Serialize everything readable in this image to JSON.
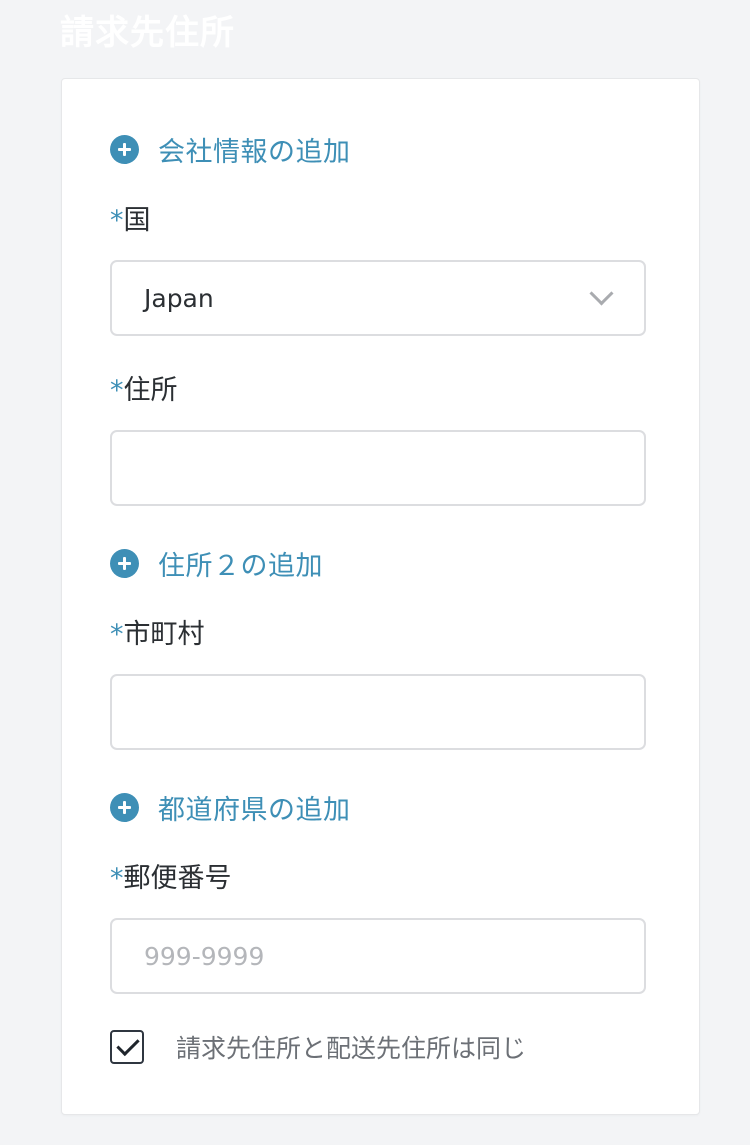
{
  "section": {
    "title": "請求先住所"
  },
  "form": {
    "add_company": {
      "label": "会社情報の追加",
      "icon": "plus-circle-icon"
    },
    "country": {
      "required_mark": "*",
      "label": "国",
      "value": "Japan",
      "icon": "chevron-down-icon"
    },
    "address": {
      "required_mark": "*",
      "label": "住所",
      "value": "",
      "placeholder": ""
    },
    "add_address2": {
      "label": "住所２の追加",
      "icon": "plus-circle-icon"
    },
    "city": {
      "required_mark": "*",
      "label": "市町村",
      "value": "",
      "placeholder": ""
    },
    "add_prefecture": {
      "label": "都道府県の追加",
      "icon": "plus-circle-icon"
    },
    "postal_code": {
      "required_mark": "*",
      "label": "郵便番号",
      "value": "",
      "placeholder": "999-9999"
    },
    "same_as_shipping": {
      "label": "請求先住所と配送先住所は同じ",
      "checked": true
    }
  },
  "colors": {
    "accent": "#3e8fb6",
    "background": "#f3f4f6",
    "card": "#ffffff",
    "border": "#dcdde0"
  }
}
